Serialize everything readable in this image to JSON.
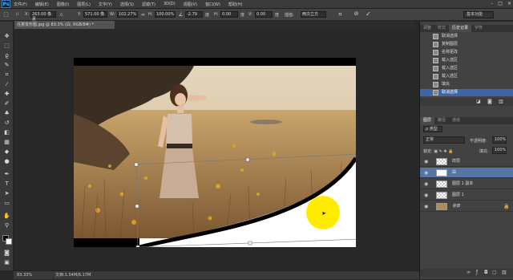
{
  "app": {
    "logo": "Ps"
  },
  "menu": [
    "文件(F)",
    "编辑(E)",
    "图像(I)",
    "图层(L)",
    "文字(Y)",
    "选择(S)",
    "滤镜(T)",
    "3D(D)",
    "视图(V)",
    "窗口(W)",
    "帮助(H)"
  ],
  "options": {
    "x_label": "X:",
    "x_value": "263.00 像素",
    "w_label": "W:",
    "w_value": "102.27%",
    "h_label": "H:",
    "h_value": "100.00%",
    "angle_value": "-2.79",
    "angle_unit": "度",
    "hskew_label": "H:",
    "hskew_value": "0.00",
    "hskew_unit": "度",
    "vskew_label": "V:",
    "vskew_value": "0.00",
    "vskew_unit": "度",
    "interp_label": "插值:",
    "interp_value": "两次立方",
    "workspace": "基本功能"
  },
  "document": {
    "tab_title": "任意变形图.jpg @ 83.3% (白, RGB/8#) *"
  },
  "history_panel": {
    "tabs": [
      "调整",
      "样式",
      "历史记录",
      "字符"
    ],
    "active_tab": "历史记录",
    "items": [
      "取消选择",
      "复制图层",
      "名称更改",
      "载入选区",
      "载入选区",
      "载入选区",
      "填充",
      "取消选择"
    ],
    "selected_index": 7
  },
  "layers_panel": {
    "tabs": [
      "图层",
      "路径",
      "通道"
    ],
    "active_tab": "图层",
    "blend_mode": "正常",
    "opacity_label": "不透明度:",
    "opacity_value": "100%",
    "fill_label": "填充:",
    "fill_value": "100%",
    "layers": [
      {
        "name": "样层",
        "selected": false
      },
      {
        "name": "白",
        "selected": true
      },
      {
        "name": "图层 1 副本",
        "selected": false
      },
      {
        "name": "图层 1",
        "selected": false
      },
      {
        "name": "背景",
        "selected": false
      }
    ]
  },
  "status": {
    "zoom": "83.33%",
    "doc_info": "文档:1.54M/6.17M"
  }
}
